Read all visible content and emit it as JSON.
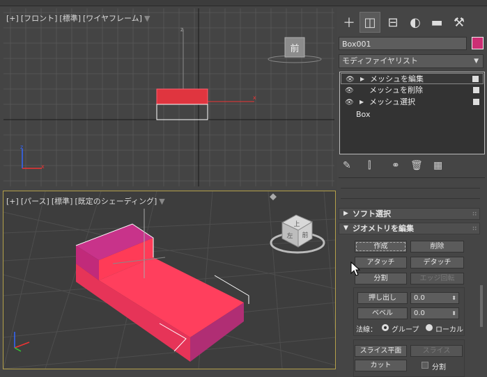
{
  "viewport_front": {
    "label": [
      "[+]",
      "[フロント]",
      "[標準]",
      "[ワイヤフレーム]"
    ],
    "viewcube_label": "前",
    "object_name": "Box001",
    "axis_labels": {
      "x": "x",
      "z": "z"
    }
  },
  "viewport_perspective": {
    "label": [
      "[+]",
      "[パース]",
      "[標準]",
      "[既定のシェーディング]"
    ],
    "viewcube_faces": {
      "top": "上",
      "front": "前",
      "left": "左"
    },
    "box_color": "#ff3b57",
    "box_top_color": "#c8338a"
  },
  "command_panel": {
    "tabs": [
      "create-icon",
      "modify-icon",
      "hierarchy-icon",
      "motion-icon",
      "display-icon",
      "utilities-icon"
    ],
    "active_tab": "modify-icon",
    "object_name": "Box001",
    "object_color": "#cc2f74",
    "modifier_list_label": "モディファイヤリスト",
    "stack": [
      {
        "label": "メッシュを編集",
        "eye": true,
        "expand": true,
        "selected": true
      },
      {
        "label": "メッシュを削除",
        "eye": true,
        "expand": false,
        "selected": false
      },
      {
        "label": "メッシュ選択",
        "eye": true,
        "expand": true,
        "selected": false
      },
      {
        "label": "Box",
        "eye": false,
        "expand": false,
        "selected": false
      }
    ],
    "rollouts": {
      "soft_select": "ソフト選択",
      "edit_geometry": "ジオメトリを編集"
    },
    "buttons": {
      "create": "作成",
      "delete": "削除",
      "attach": "アタッチ",
      "detach": "デタッチ",
      "divide": "分割",
      "turn_edge": "エッジ回転",
      "extrude": "押し出し",
      "bevel": "ベベル",
      "slice_plane": "スライス平面",
      "slice": "スライス",
      "cut": "カット"
    },
    "extrude_value": "0.0",
    "bevel_value": "0.0",
    "normals_label": "法線：",
    "normals_group": "グループ",
    "normals_local": "ローカル",
    "split_label": "分割"
  }
}
